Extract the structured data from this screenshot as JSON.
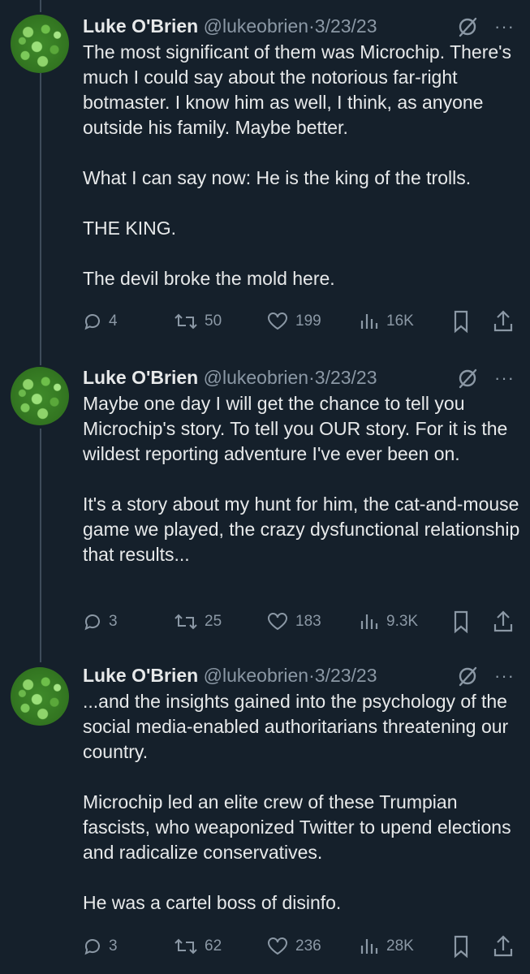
{
  "tweets": [
    {
      "name": "Luke O'Brien",
      "handle": "@lukeobrien",
      "dot": "·",
      "date": "3/23/23",
      "more": "···",
      "paragraphs": [
        "The most significant of them was Microchip. There's much I could say about the notorious far-right botmaster. I know him as well, I think, as anyone outside his family. Maybe better.",
        "What I can say now: He is the king of the trolls.",
        "THE KING.",
        "The devil broke the mold here."
      ],
      "replies": "4",
      "retweets": "50",
      "likes": "199",
      "views": "16K"
    },
    {
      "name": "Luke O'Brien",
      "handle": "@lukeobrien",
      "dot": "·",
      "date": "3/23/23",
      "more": "···",
      "paragraphs": [
        "Maybe one day I will get the chance to tell you Microchip's story. To tell you OUR story. For it is the wildest reporting adventure I've ever been on.",
        "It's a story about my hunt for him, the cat-and-mouse game we played, the crazy dysfunctional relationship that results..."
      ],
      "replies": "3",
      "retweets": "25",
      "likes": "183",
      "views": "9.3K"
    },
    {
      "name": "Luke O'Brien",
      "handle": "@lukeobrien",
      "dot": "·",
      "date": "3/23/23",
      "more": "···",
      "paragraphs": [
        "...and the insights gained into the psychology of the social media-enabled authoritarians threatening our country.",
        "Microchip led an elite crew of these Trumpian fascists, who weaponized Twitter to upend elections and radicalize conservatives.",
        "He was a cartel boss of disinfo."
      ],
      "replies": "3",
      "retweets": "62",
      "likes": "236",
      "views": "28K"
    }
  ],
  "colors": {
    "background": "#15202b",
    "text": "#e7e9ea",
    "muted": "#8b98a5",
    "thread_line": "#3e4c5a"
  },
  "icons": [
    "grok-icon",
    "more-icon",
    "reply-icon",
    "retweet-icon",
    "like-icon",
    "views-icon",
    "bookmark-icon",
    "share-icon"
  ]
}
